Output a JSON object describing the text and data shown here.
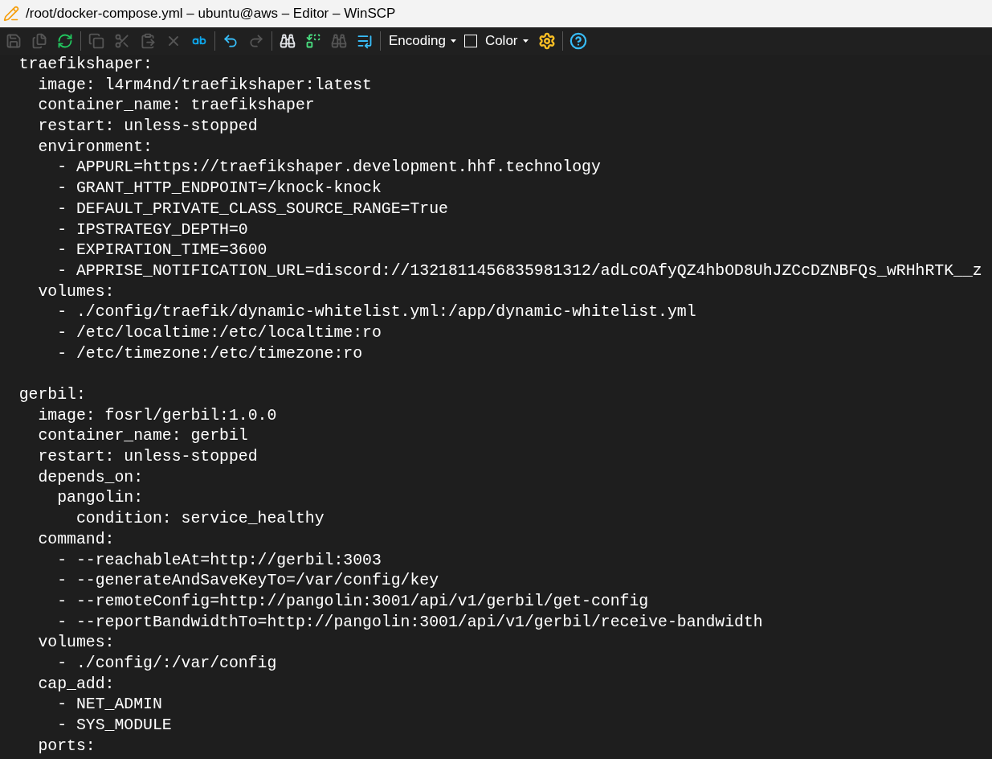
{
  "window": {
    "title": "/root/docker-compose.yml – ubuntu@aws – Editor – WinSCP"
  },
  "toolbar": {
    "buttons": [
      {
        "kind": "save",
        "disabled": true
      },
      {
        "kind": "save-all",
        "disabled": true
      },
      {
        "kind": "reload",
        "disabled": false
      },
      {
        "kind": "copy",
        "disabled": true
      },
      {
        "kind": "cut",
        "disabled": true
      },
      {
        "kind": "paste",
        "disabled": true
      },
      {
        "kind": "delete",
        "disabled": true
      },
      {
        "kind": "select-all",
        "disabled": false
      },
      {
        "kind": "undo",
        "disabled": false
      },
      {
        "kind": "redo",
        "disabled": true
      },
      {
        "kind": "find",
        "disabled": false
      },
      {
        "kind": "replace",
        "disabled": false
      },
      {
        "kind": "find-next",
        "disabled": true
      },
      {
        "kind": "goto-line",
        "disabled": false
      }
    ],
    "encoding": {
      "label": "Encoding"
    },
    "color": {
      "label": "Color",
      "checked": false
    }
  },
  "editor": {
    "blocks": [
      [
        "  traefikshaper:",
        "    image: l4rm4nd/traefikshaper:latest",
        "    container_name: traefikshaper",
        "    restart: unless-stopped",
        "    environment:",
        "      - APPURL=https://traefikshaper.development.hhf.technology",
        "      - GRANT_HTTP_ENDPOINT=/knock-knock",
        "      - DEFAULT_PRIVATE_CLASS_SOURCE_RANGE=True",
        "      - IPSTRATEGY_DEPTH=0",
        "      - EXPIRATION_TIME=3600",
        "      - APPRISE_NOTIFICATION_URL=discord://1321811456835981312/adLcOAfyQZ4hbOD8UhJZCcDZNBFQs_wRHhRTK__z",
        "    volumes:",
        "      - ./config/traefik/dynamic-whitelist.yml:/app/dynamic-whitelist.yml",
        "      - /etc/localtime:/etc/localtime:ro",
        "      - /etc/timezone:/etc/timezone:ro"
      ],
      [
        "  gerbil:",
        "    image: fosrl/gerbil:1.0.0",
        "    container_name: gerbil",
        "    restart: unless-stopped",
        "    depends_on:",
        "      pangolin:",
        "        condition: service_healthy",
        "    command:",
        "      - --reachableAt=http://gerbil:3003",
        "      - --generateAndSaveKeyTo=/var/config/key",
        "      - --remoteConfig=http://pangolin:3001/api/v1/gerbil/get-config",
        "      - --reportBandwidthTo=http://pangolin:3001/api/v1/gerbil/receive-bandwidth",
        "    volumes:",
        "      - ./config/:/var/config",
        "    cap_add:",
        "      - NET_ADMIN",
        "      - SYS_MODULE",
        "    ports:"
      ]
    ]
  }
}
